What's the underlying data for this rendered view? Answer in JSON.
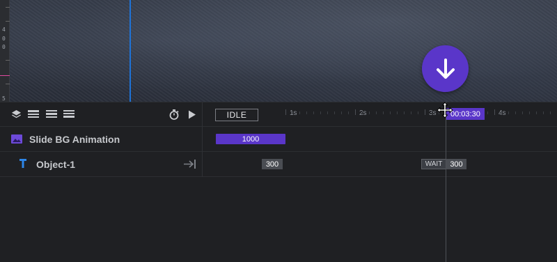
{
  "stage": {
    "ruler_numbers": [
      "4",
      "0",
      "0",
      "5"
    ]
  },
  "scroll_button": {
    "icon": "arrow-down-icon"
  },
  "timeline": {
    "state_label": "IDLE",
    "time_marks": [
      "1s",
      "2s",
      "3s",
      "4s"
    ],
    "current_time": "00:03:30",
    "header_icons": [
      "layers-icon",
      "align-top-icon",
      "align-middle-icon",
      "align-bottom-icon",
      "stopwatch-icon",
      "play-icon"
    ]
  },
  "layers": [
    {
      "name": "Slide BG Animation",
      "icon": "image-icon",
      "duration": "1000"
    },
    {
      "name": "Object-1",
      "icon": "text-icon",
      "in_duration": "300",
      "wait_label": "WAIT",
      "out_duration": "300"
    }
  ],
  "colors": {
    "accent": "#5a36c9",
    "guide_blue": "#1e73d8",
    "background": "#1f2023"
  }
}
